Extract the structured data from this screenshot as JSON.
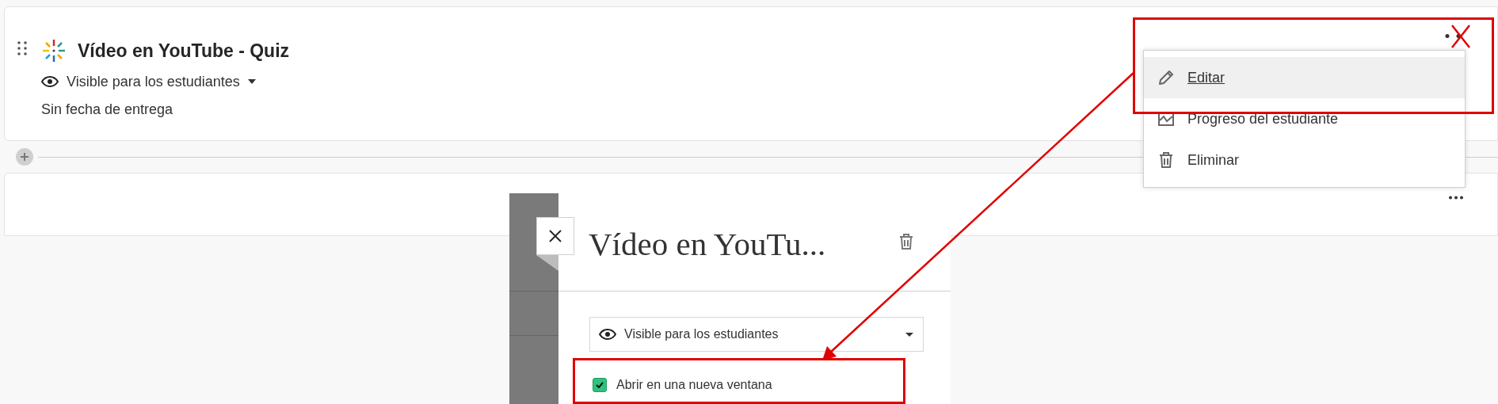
{
  "item": {
    "title": "Vídeo en YouTube - Quiz",
    "visibility": "Visible para los estudiantes",
    "due": "Sin fecha de entrega"
  },
  "menu": {
    "items": [
      {
        "label": "Editar",
        "kind": "edit",
        "selected": true
      },
      {
        "label": "Progreso del estudiante",
        "kind": "progress",
        "selected": false
      },
      {
        "label": "Eliminar",
        "kind": "delete",
        "selected": false
      }
    ]
  },
  "panel": {
    "title": "Vídeo en YouTu...",
    "visibility": "Visible para los estudiantes",
    "open_new_window": {
      "label": "Abrir en una nueva ventana",
      "checked": true
    }
  }
}
